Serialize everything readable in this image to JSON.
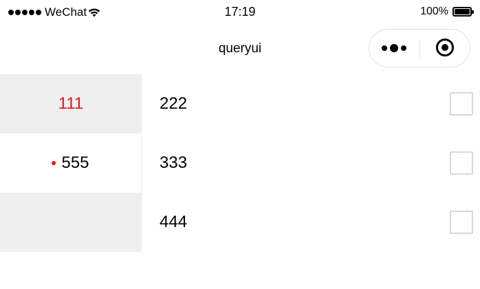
{
  "status_bar": {
    "carrier": "WeChat",
    "time": "17:19",
    "battery_percent": "100%"
  },
  "nav": {
    "title": "queryui"
  },
  "sidebar": {
    "items": [
      {
        "label": "111",
        "selected": true,
        "color": "#e8141b"
      },
      {
        "label": "555",
        "badge_dot": true
      },
      {
        "label": ""
      }
    ]
  },
  "list": {
    "items": [
      {
        "label": "222",
        "checked": false
      },
      {
        "label": "333",
        "checked": false
      },
      {
        "label": "444",
        "checked": false
      }
    ]
  },
  "colors": {
    "accent_red": "#e8141b",
    "sidebar_gray": "#efefef"
  }
}
